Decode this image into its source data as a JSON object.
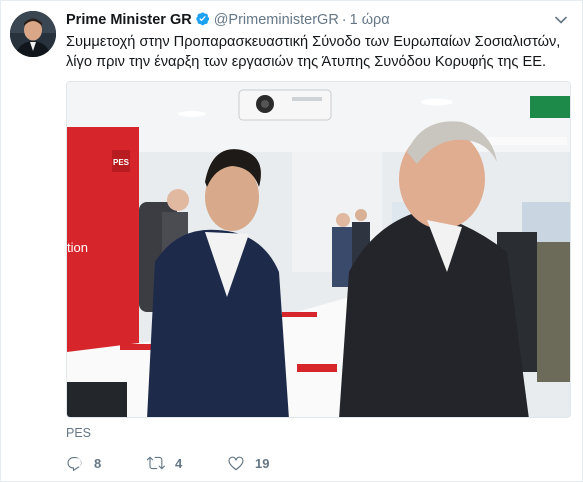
{
  "tweet": {
    "display_name": "Prime Minister GR",
    "handle": "@PrimeministerGR",
    "separator": "·",
    "time": "1 ώρα",
    "text_lines": [
      "Συμμετοχή στην Προπαρασκευαστική Σύνοδο των Ευρωπαίων Σοσιαλιστών,",
      "λίγο πριν την έναρξη των εργασιών της Άτυπης Συνόδου Κορυφής της ΕΕ."
    ],
    "media_caption": "PES",
    "media_banner_text": "PES",
    "media_wall_text": "tion"
  },
  "actions": {
    "reply_count": "8",
    "retweet_count": "4",
    "like_count": "19"
  },
  "colors": {
    "verified": "#1da1f2",
    "muted": "#657786",
    "pes_red": "#d7262b"
  },
  "icons": {
    "verified": "verified-badge-icon",
    "caret": "chevron-down-icon",
    "reply": "reply-icon",
    "retweet": "retweet-icon",
    "like": "heart-icon"
  }
}
